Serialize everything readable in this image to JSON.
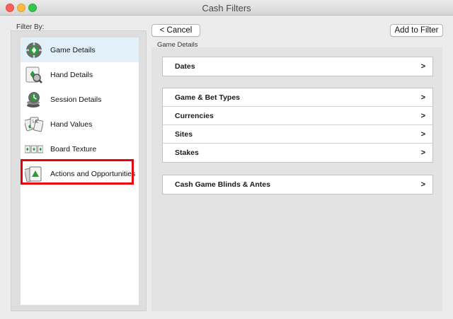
{
  "window": {
    "title": "Cash Filters"
  },
  "sidebar": {
    "heading": "Filter By:",
    "items": [
      {
        "label": "Game Details",
        "icon": "game-details-icon"
      },
      {
        "label": "Hand Details",
        "icon": "hand-details-icon"
      },
      {
        "label": "Session Details",
        "icon": "session-details-icon"
      },
      {
        "label": "Hand Values",
        "icon": "hand-values-icon"
      },
      {
        "label": "Board Texture",
        "icon": "board-texture-icon"
      },
      {
        "label": "Actions and Opportunities",
        "icon": "actions-opportunities-icon"
      }
    ],
    "selected": "Game Details"
  },
  "toolbar": {
    "cancel_label": "< Cancel",
    "add_label": "Add to Filter"
  },
  "main": {
    "section_title": "Game Details",
    "groups": [
      {
        "rows": [
          {
            "label": "Dates",
            "chevron": ">"
          }
        ]
      },
      {
        "rows": [
          {
            "label": "Game & Bet Types",
            "chevron": ">"
          },
          {
            "label": "Currencies",
            "chevron": ">"
          },
          {
            "label": "Sites",
            "chevron": ">"
          },
          {
            "label": "Stakes",
            "chevron": ">"
          }
        ]
      },
      {
        "rows": [
          {
            "label": "Cash Game Blinds & Antes",
            "chevron": ">"
          }
        ]
      }
    ]
  },
  "colors": {
    "selected_row": "#e2f1f9",
    "highlight": "#e8000b",
    "icon_green": "#2e9c3a"
  }
}
